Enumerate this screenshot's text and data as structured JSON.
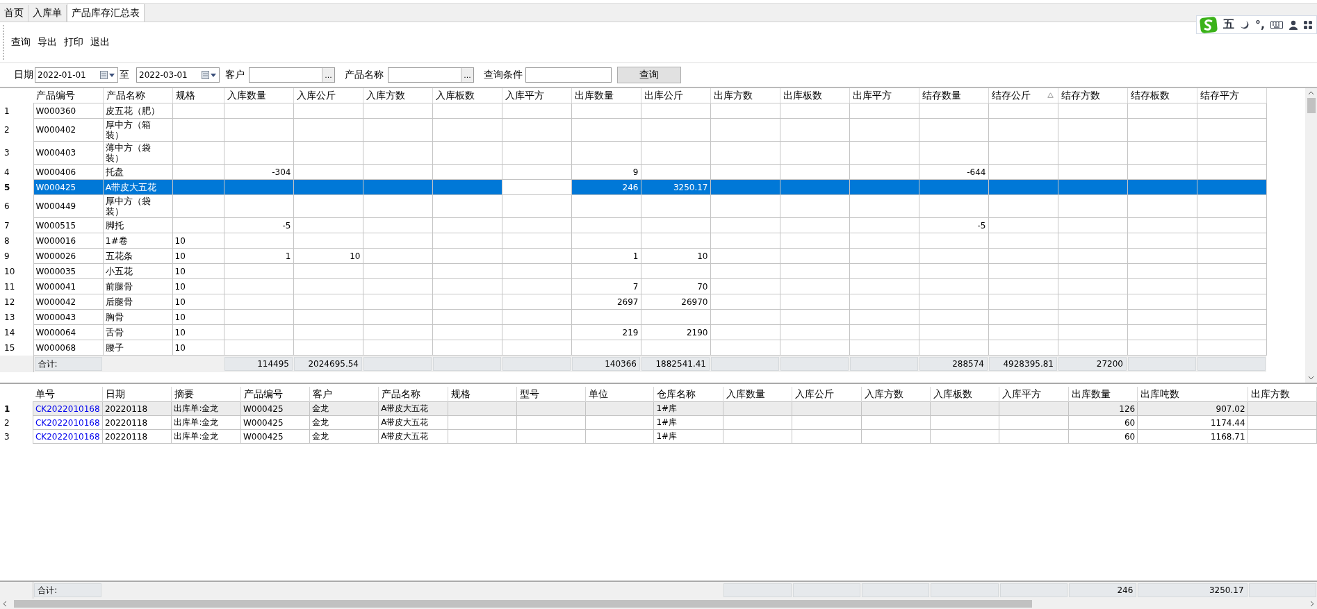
{
  "tabs": [
    {
      "label": "首页",
      "selected": false
    },
    {
      "label": "入库单",
      "selected": false
    },
    {
      "label": "产品库存汇总表",
      "selected": true
    }
  ],
  "toolbar": [
    "查询",
    "导出",
    "打印",
    "退出"
  ],
  "ime_toolbar": {
    "mode": "五",
    "punct": "°,"
  },
  "filters": {
    "date_label": "日期",
    "date_from": "2022-01-01",
    "to_label": "至",
    "date_to": "2022-03-01",
    "customer_label": "客户",
    "customer_browse": "...",
    "product_label": "产品名称",
    "product_browse": "...",
    "condition_label": "查询条件",
    "query_button": "查询"
  },
  "main_grid": {
    "columns": [
      {
        "label": "产品编号",
        "kind": "text",
        "sorted": false,
        "focused": false,
        "total": "合计:"
      },
      {
        "label": "产品名称",
        "kind": "wrap",
        "sorted": false,
        "focused": false
      },
      {
        "label": "规格",
        "kind": "text",
        "sorted": false,
        "focused": false
      },
      {
        "label": "入库数量",
        "kind": "number",
        "sorted": false,
        "focused": false,
        "total": "114495"
      },
      {
        "label": "入库公斤",
        "kind": "number",
        "sorted": false,
        "focused": false,
        "total": "2024695.54"
      },
      {
        "label": "入库方数",
        "kind": "number",
        "sorted": false,
        "focused": false
      },
      {
        "label": "入库板数",
        "kind": "number",
        "sorted": false,
        "focused": false
      },
      {
        "label": "入库平方",
        "kind": "number",
        "sorted": false,
        "focused": true
      },
      {
        "label": "出库数量",
        "kind": "number",
        "sorted": false,
        "focused": false,
        "total": "140366"
      },
      {
        "label": "出库公斤",
        "kind": "number",
        "sorted": false,
        "focused": false,
        "total": "1882541.41"
      },
      {
        "label": "出库方数",
        "kind": "number",
        "sorted": false,
        "focused": false
      },
      {
        "label": "出库板数",
        "kind": "number",
        "sorted": false,
        "focused": false
      },
      {
        "label": "出库平方",
        "kind": "number",
        "sorted": false,
        "focused": false
      },
      {
        "label": "结存数量",
        "kind": "number",
        "sorted": false,
        "focused": false,
        "total": "288574"
      },
      {
        "label": "结存公斤",
        "kind": "number",
        "sorted": true,
        "focused": false,
        "total": "4928395.81"
      },
      {
        "label": "结存方数",
        "kind": "number",
        "sorted": false,
        "focused": false,
        "total": "27200"
      },
      {
        "label": "结存板数",
        "kind": "number",
        "sorted": false,
        "focused": false
      },
      {
        "label": "结存平方",
        "kind": "number",
        "sorted": false,
        "focused": false
      }
    ],
    "rows": [
      {
        "no": "1",
        "selected": false,
        "cells": [
          {
            "text": "W000360"
          },
          {
            "text": "皮五花（肥）"
          },
          {},
          {},
          {},
          {},
          {},
          {},
          {},
          {},
          {},
          {},
          {},
          {},
          {},
          {},
          {},
          {}
        ]
      },
      {
        "no": "2",
        "selected": false,
        "cells": [
          {
            "text": "W000402"
          },
          {
            "text": "厚中方（箱装）"
          },
          {},
          {},
          {},
          {},
          {},
          {},
          {},
          {},
          {},
          {},
          {},
          {},
          {},
          {},
          {},
          {}
        ]
      },
      {
        "no": "3",
        "selected": false,
        "cells": [
          {
            "text": "W000403"
          },
          {
            "text": "薄中方（袋装）"
          },
          {},
          {},
          {},
          {},
          {},
          {},
          {},
          {},
          {},
          {},
          {},
          {},
          {},
          {},
          {},
          {}
        ]
      },
      {
        "no": "4",
        "selected": false,
        "cells": [
          {
            "text": "W000406"
          },
          {
            "text": "托盘"
          },
          {},
          {
            "text": "-304"
          },
          {},
          {},
          {},
          {},
          {
            "text": "9"
          },
          {},
          {},
          {},
          {},
          {
            "text": "-644"
          },
          {},
          {},
          {},
          {}
        ]
      },
      {
        "no": "5",
        "selected": true,
        "cells": [
          {
            "text": "W000425"
          },
          {
            "text": "A带皮大五花"
          },
          {},
          {},
          {},
          {},
          {},
          {},
          {
            "text": "246"
          },
          {
            "text": "3250.17"
          },
          {},
          {},
          {},
          {},
          {},
          {},
          {},
          {}
        ]
      },
      {
        "no": "6",
        "selected": false,
        "cells": [
          {
            "text": "W000449"
          },
          {
            "text": "厚中方（袋装）"
          },
          {},
          {},
          {},
          {},
          {},
          {},
          {},
          {},
          {},
          {},
          {},
          {},
          {},
          {},
          {},
          {}
        ]
      },
      {
        "no": "7",
        "selected": false,
        "cells": [
          {
            "text": "W000515"
          },
          {
            "text": "脚托"
          },
          {},
          {
            "text": "-5"
          },
          {},
          {},
          {},
          {},
          {},
          {},
          {},
          {},
          {},
          {
            "text": "-5"
          },
          {},
          {},
          {},
          {}
        ]
      },
      {
        "no": "8",
        "selected": false,
        "cells": [
          {
            "text": "W000016"
          },
          {
            "text": "1#卷"
          },
          {
            "text": "10"
          },
          {},
          {},
          {},
          {},
          {},
          {},
          {},
          {},
          {},
          {},
          {},
          {},
          {},
          {},
          {}
        ]
      },
      {
        "no": "9",
        "selected": false,
        "cells": [
          {
            "text": "W000026"
          },
          {
            "text": "五花条"
          },
          {
            "text": "10"
          },
          {
            "text": "1"
          },
          {
            "text": "10"
          },
          {},
          {},
          {},
          {
            "text": "1"
          },
          {
            "text": "10"
          },
          {},
          {},
          {},
          {},
          {},
          {},
          {},
          {}
        ]
      },
      {
        "no": "10",
        "selected": false,
        "cells": [
          {
            "text": "W000035"
          },
          {
            "text": "小五花"
          },
          {
            "text": "10"
          },
          {},
          {},
          {},
          {},
          {},
          {},
          {},
          {},
          {},
          {},
          {},
          {},
          {},
          {},
          {}
        ]
      },
      {
        "no": "11",
        "selected": false,
        "cells": [
          {
            "text": "W000041"
          },
          {
            "text": "前腿骨"
          },
          {
            "text": "10"
          },
          {},
          {},
          {},
          {},
          {},
          {
            "text": "7"
          },
          {
            "text": "70"
          },
          {},
          {},
          {},
          {},
          {},
          {},
          {},
          {}
        ]
      },
      {
        "no": "12",
        "selected": false,
        "cells": [
          {
            "text": "W000042"
          },
          {
            "text": "后腿骨"
          },
          {
            "text": "10"
          },
          {},
          {},
          {},
          {},
          {},
          {
            "text": "2697"
          },
          {
            "text": "26970"
          },
          {},
          {},
          {},
          {},
          {},
          {},
          {},
          {}
        ]
      },
      {
        "no": "13",
        "selected": false,
        "cells": [
          {
            "text": "W000043"
          },
          {
            "text": "胸骨"
          },
          {
            "text": "10"
          },
          {},
          {},
          {},
          {},
          {},
          {},
          {},
          {},
          {},
          {},
          {},
          {},
          {},
          {},
          {}
        ]
      },
      {
        "no": "14",
        "selected": false,
        "cells": [
          {
            "text": "W000064"
          },
          {
            "text": "舌骨"
          },
          {
            "text": "10"
          },
          {},
          {},
          {},
          {},
          {},
          {
            "text": "219"
          },
          {
            "text": "2190"
          },
          {},
          {},
          {},
          {},
          {},
          {},
          {},
          {}
        ]
      },
      {
        "no": "15",
        "selected": false,
        "cells": [
          {
            "text": "W000068"
          },
          {
            "text": "腰子"
          },
          {
            "text": "10"
          },
          {},
          {},
          {},
          {},
          {},
          {},
          {},
          {},
          {},
          {},
          {},
          {},
          {},
          {},
          {}
        ]
      }
    ],
    "selected_row_focus": true
  },
  "detail_grid": {
    "columns": [
      {
        "label": "单号",
        "kind": "link",
        "total": "合计:"
      },
      {
        "label": "日期",
        "kind": "text"
      },
      {
        "label": "摘要",
        "kind": "text"
      },
      {
        "label": "产品编号",
        "kind": "text"
      },
      {
        "label": "客户",
        "kind": "text"
      },
      {
        "label": "产品名称",
        "kind": "text"
      },
      {
        "label": "规格",
        "kind": "text"
      },
      {
        "label": "型号",
        "kind": "text"
      },
      {
        "label": "单位",
        "kind": "text"
      },
      {
        "label": "仓库名称",
        "kind": "text"
      },
      {
        "label": "入库数量",
        "kind": "number"
      },
      {
        "label": "入库公斤",
        "kind": "number"
      },
      {
        "label": "入库方数",
        "kind": "number"
      },
      {
        "label": "入库板数",
        "kind": "number"
      },
      {
        "label": "入库平方",
        "kind": "number"
      },
      {
        "label": "出库数量",
        "kind": "number",
        "total": "246"
      },
      {
        "label": "出库吨数",
        "kind": "number",
        "total": "3250.17"
      },
      {
        "label": "出库方数",
        "kind": "number"
      }
    ],
    "rows": [
      {
        "no": "1",
        "selected": true,
        "cells": [
          {
            "text": "CK2022010168"
          },
          {
            "text": "20220118"
          },
          {
            "text": "出库单:金龙"
          },
          {
            "text": "W000425"
          },
          {
            "text": "金龙"
          },
          {
            "text": "A带皮大五花"
          },
          {},
          {},
          {},
          {
            "text": "1#库"
          },
          {},
          {},
          {},
          {},
          {},
          {
            "text": "126"
          },
          {
            "text": "907.02"
          },
          {}
        ]
      },
      {
        "no": "2",
        "selected": false,
        "cells": [
          {
            "text": "CK2022010168"
          },
          {
            "text": "20220118"
          },
          {
            "text": "出库单:金龙"
          },
          {
            "text": "W000425"
          },
          {
            "text": "金龙"
          },
          {
            "text": "A带皮大五花"
          },
          {},
          {},
          {},
          {
            "text": "1#库"
          },
          {},
          {},
          {},
          {},
          {},
          {
            "text": "60"
          },
          {
            "text": "1174.44"
          },
          {}
        ]
      },
      {
        "no": "3",
        "selected": false,
        "cells": [
          {
            "text": "CK2022010168"
          },
          {
            "text": "20220118"
          },
          {
            "text": "出库单:金龙"
          },
          {
            "text": "W000425"
          },
          {
            "text": "金龙"
          },
          {
            "text": "A带皮大五花"
          },
          {},
          {},
          {},
          {
            "text": "1#库"
          },
          {},
          {},
          {},
          {},
          {},
          {
            "text": "60"
          },
          {
            "text": "1168.71"
          },
          {}
        ]
      }
    ],
    "current_row_shading": true
  }
}
